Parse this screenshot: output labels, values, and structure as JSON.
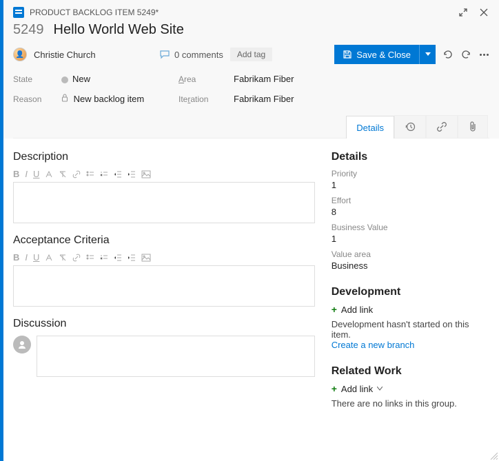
{
  "header": {
    "breadcrumb": "PRODUCT BACKLOG ITEM 5249*",
    "id": "5249",
    "title": "Hello World Web Site"
  },
  "person": {
    "name": "Christie Church"
  },
  "toolbar": {
    "comments_label": "0 comments",
    "add_tag_label": "Add tag",
    "save_label": "Save & Close"
  },
  "fields": {
    "state": {
      "label": "State",
      "value": "New"
    },
    "reason": {
      "label": "Reason",
      "value": "New backlog item"
    },
    "area": {
      "label_html": "Area",
      "value": "Fabrikam Fiber"
    },
    "iteration": {
      "label_html": "Iteration",
      "value": "Fabrikam Fiber"
    }
  },
  "tabs": {
    "details": "Details"
  },
  "left": {
    "description_title": "Description",
    "acceptance_title": "Acceptance Criteria",
    "discussion_title": "Discussion"
  },
  "right": {
    "details_title": "Details",
    "priority_label": "Priority",
    "priority_value": "1",
    "effort_label": "Effort",
    "effort_value": "8",
    "bv_label": "Business Value",
    "bv_value": "1",
    "va_label": "Value area",
    "va_value": "Business",
    "dev_title": "Development",
    "add_link": "Add link",
    "dev_text": "Development hasn't started on this item.",
    "dev_link": "Create a new branch",
    "related_title": "Related Work",
    "related_text": "There are no links in this group."
  }
}
